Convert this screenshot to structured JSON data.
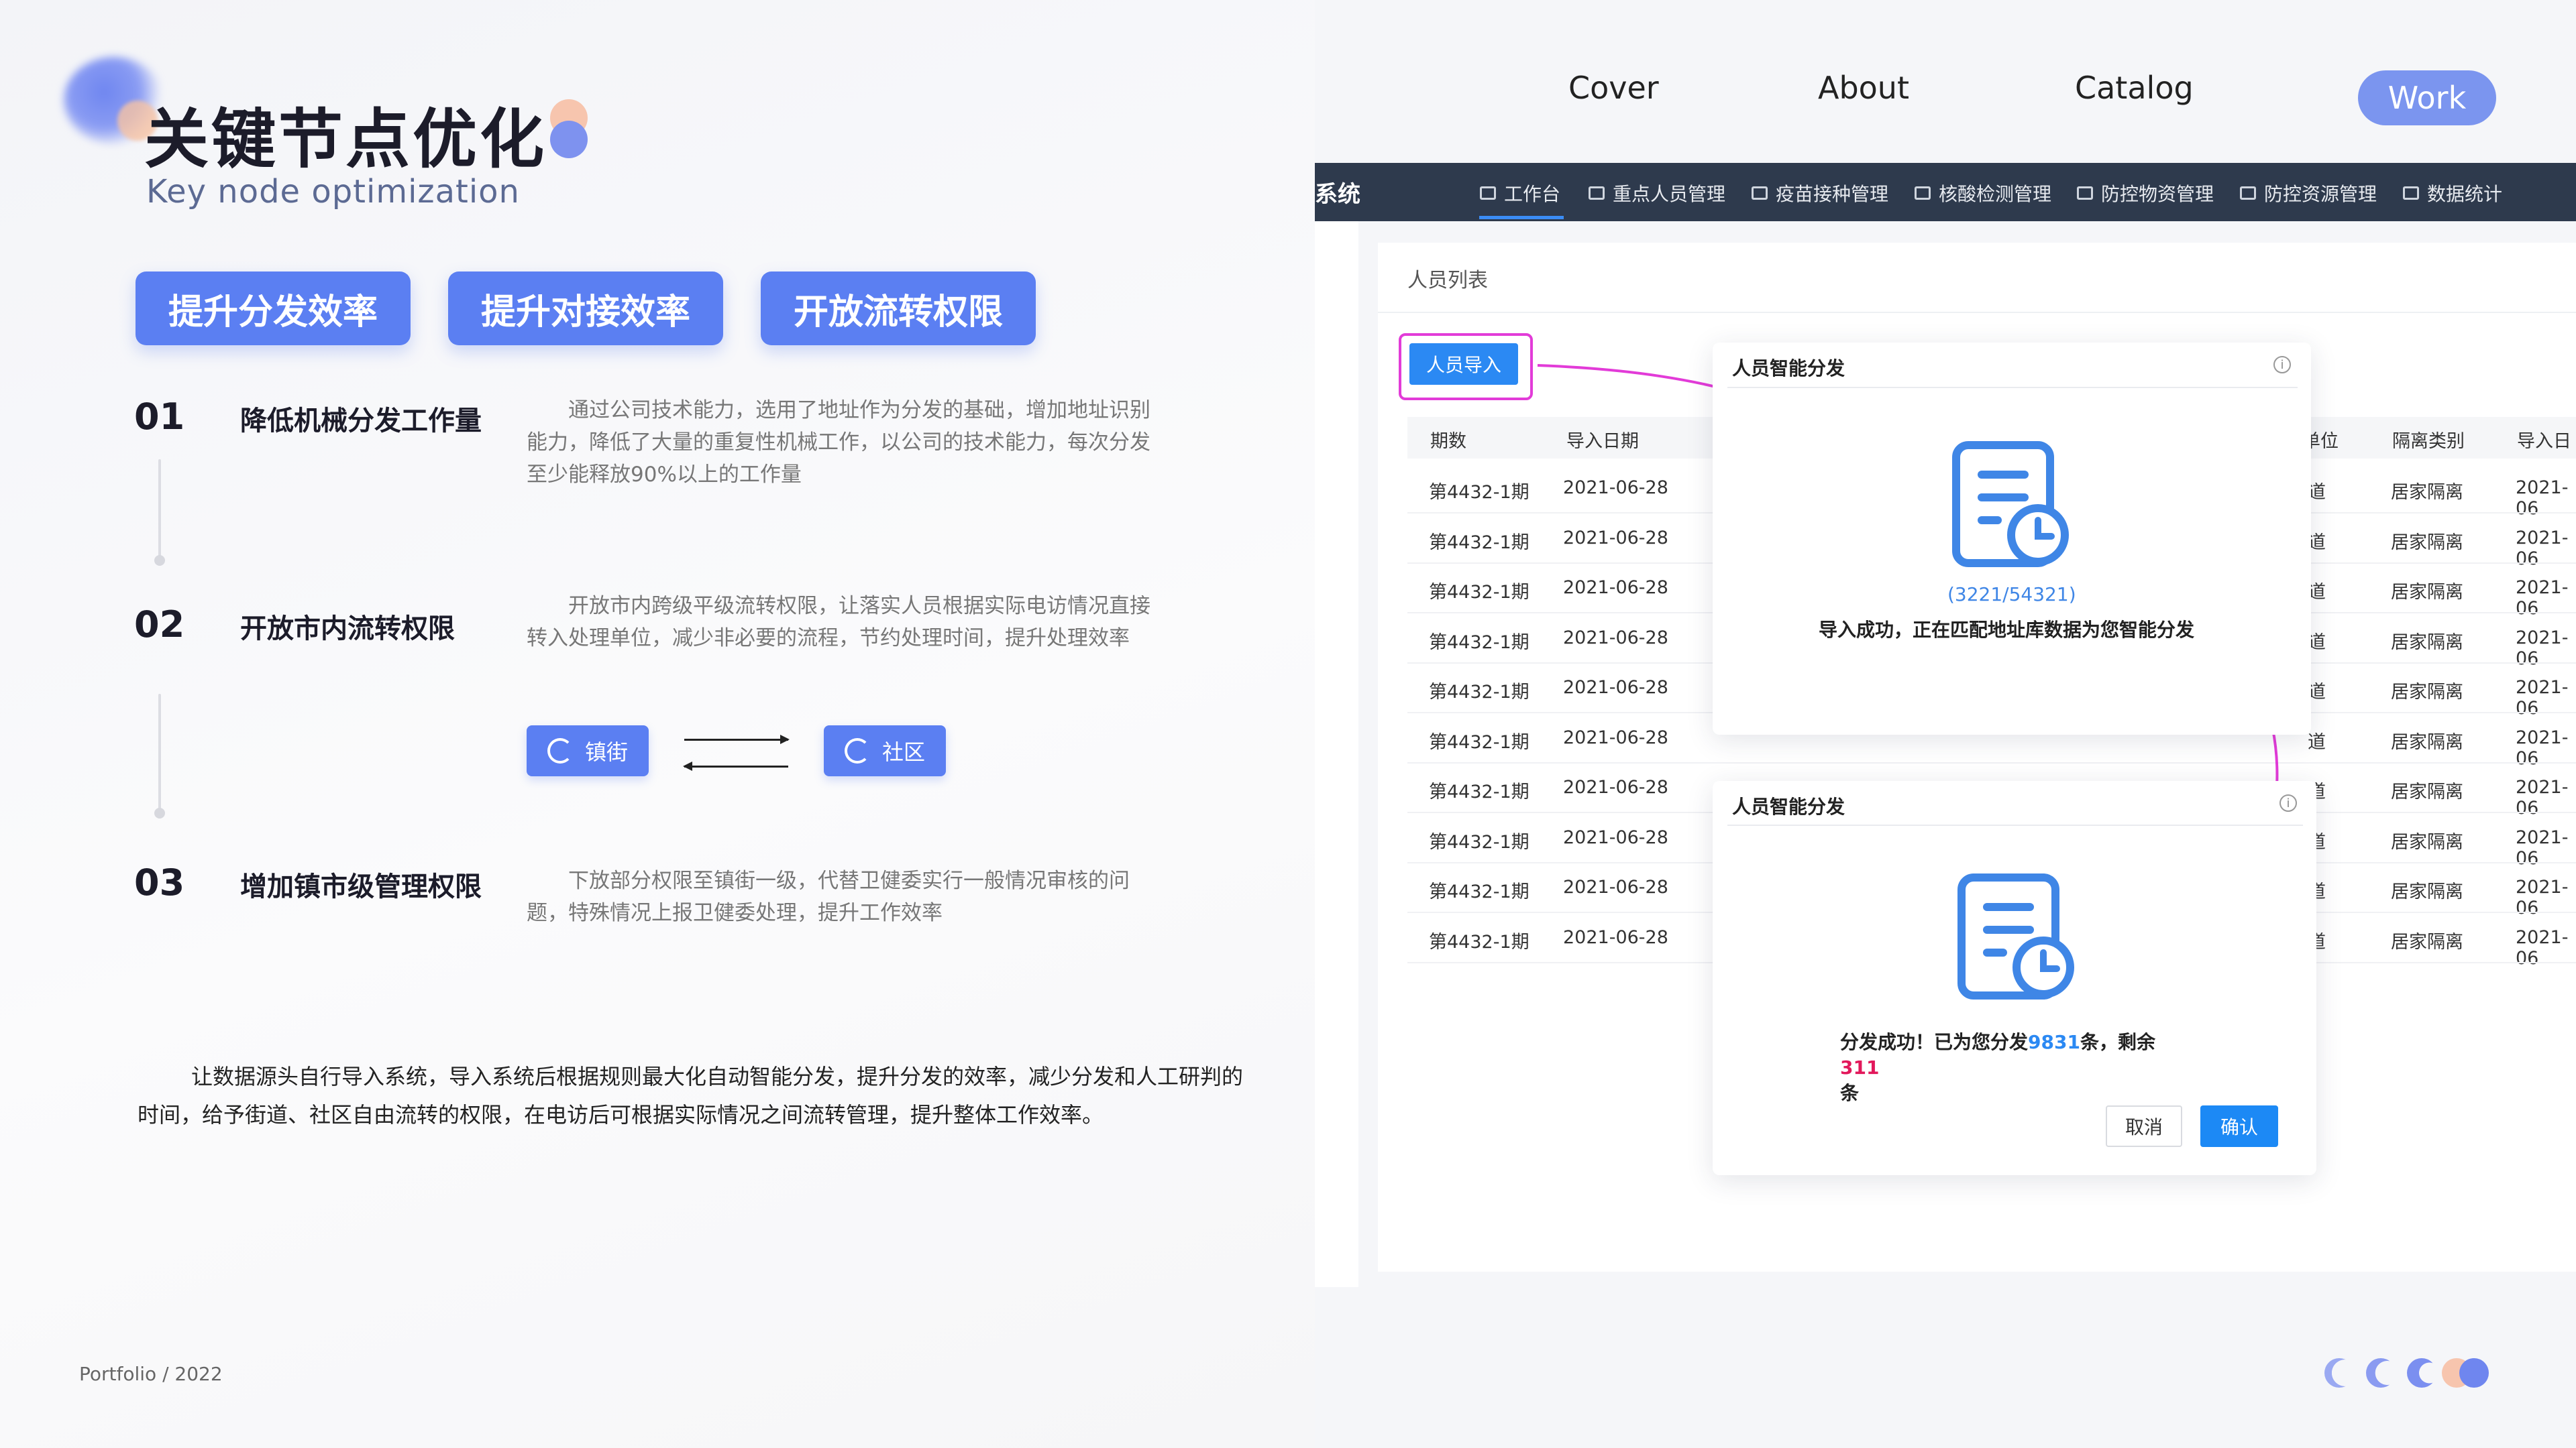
{
  "colors": {
    "accent": "#5b7ff2",
    "primary_button": "#1c89f5",
    "highlight_frame": "#e23bd8",
    "count_blue": "#2b89f3",
    "count_red": "#e2185b",
    "topbar": "#2e3a4d"
  },
  "header": {
    "title": "关键节点优化",
    "subtitle": "Key node optimization"
  },
  "pills": [
    "提升分发效率",
    "提升对接效率",
    "开放流转权限"
  ],
  "items": [
    {
      "num": "01",
      "heading": "降低机械分发工作量",
      "text": "通过公司技术能力，选用了地址作为分发的基础，增加地址识别能力，降低了大量的重复性机械工作，以公司的技术能力，每次分发至少能释放90%以上的工作量"
    },
    {
      "num": "02",
      "heading": "开放市内流转权限",
      "text": "开放市内跨级平级流转权限，让落实人员根据实际电访情况直接转入处理单位，减少非必要的流程，节约处理时间，提升处理效率"
    },
    {
      "num": "03",
      "heading": "增加镇市级管理权限",
      "text": "下放部分权限至镇街一级，代替卫健委实行一般情况审核的问题，特殊情况上报卫健委处理，提升工作效率"
    }
  ],
  "flow": {
    "left": "镇街",
    "right": "社区",
    "icon": "refresh-icon"
  },
  "summary": "让数据源头自行导入系统，导入系统后根据规则最大化自动智能分发，提升分发的效率，减少分发和人工研判的时间，给予街道、社区自由流转的权限，在电访后可根据实际情况之间流转管理，提升整体工作效率。",
  "footer": "Portfolio / 2022",
  "nav": [
    "Cover",
    "About",
    "Catalog",
    "Work"
  ],
  "nav_active": "Work",
  "app": {
    "system_name": "系统",
    "menu": [
      "工作台",
      "重点人员管理",
      "疫苗接种管理",
      "核酸检测管理",
      "防控物资管理",
      "防控资源管理",
      "数据统计"
    ],
    "panel_title": "人员列表",
    "import_button": "人员导入",
    "columns": [
      "期数",
      "导入日期",
      "单位",
      "隔离类别",
      "导入日"
    ],
    "rows": [
      [
        "第4432-1期",
        "2021-06-28",
        "道",
        "居家隔离",
        "2021-06"
      ],
      [
        "第4432-1期",
        "2021-06-28",
        "道",
        "居家隔离",
        "2021-06"
      ],
      [
        "第4432-1期",
        "2021-06-28",
        "道",
        "居家隔离",
        "2021-06"
      ],
      [
        "第4432-1期",
        "2021-06-28",
        "道",
        "居家隔离",
        "2021-06"
      ],
      [
        "第4432-1期",
        "2021-06-28",
        "道",
        "居家隔离",
        "2021-06"
      ],
      [
        "第4432-1期",
        "2021-06-28",
        "道",
        "居家隔离",
        "2021-06"
      ],
      [
        "第4432-1期",
        "2021-06-28",
        "道",
        "居家隔离",
        "2021-06"
      ],
      [
        "第4432-1期",
        "2021-06-28",
        "道",
        "居家隔离",
        "2021-06"
      ],
      [
        "第4432-1期",
        "2021-06-28",
        "道",
        "居家隔离",
        "2021-06"
      ],
      [
        "第4432-1期",
        "2021-06-28",
        "道",
        "居家隔离",
        "2021-06"
      ]
    ],
    "dialog1": {
      "title": "人员智能分发",
      "progress": "(3221/54321)",
      "message": "导入成功，正在匹配地址库数据为您智能分发"
    },
    "dialog2": {
      "title": "人员智能分发",
      "msg_prefix": "分发成功！已为您分发",
      "count": "9831",
      "msg_mid": "条，剩余",
      "remaining": "311",
      "msg_suffix": "条",
      "cancel": "取消",
      "confirm": "确认"
    }
  }
}
